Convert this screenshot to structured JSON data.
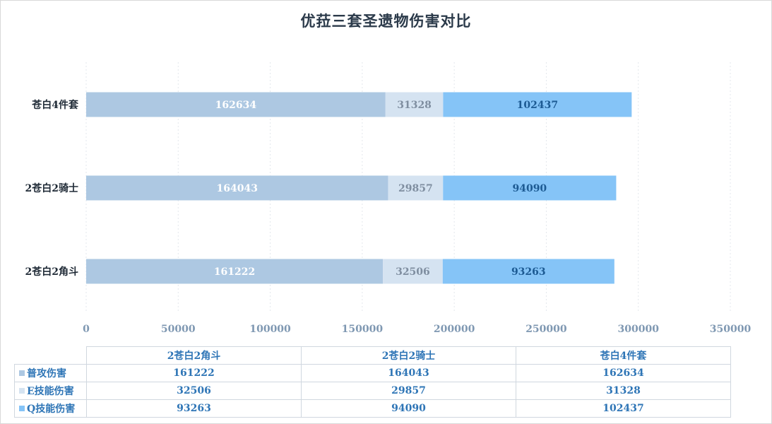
{
  "chart_data": {
    "type": "bar",
    "orientation": "horizontal",
    "stacked": true,
    "title": "优菈三套圣遗物伤害对比",
    "categories": [
      "2苍白2角斗",
      "2苍白2骑士",
      "苍白4件套"
    ],
    "series": [
      {
        "name": "普攻伤害",
        "values": [
          161222,
          164043,
          162634
        ],
        "color": "#adc8e2",
        "label_color": "#ffffff"
      },
      {
        "name": "E技能伤害",
        "values": [
          32506,
          29857,
          31328
        ],
        "color": "#d5e3f1",
        "label_color": "#7f8ea0"
      },
      {
        "name": "Q技能伤害",
        "values": [
          93263,
          94090,
          102437
        ],
        "color": "#85c4f7",
        "label_color": "#1c5a93"
      }
    ],
    "xlim": [
      0,
      350000
    ],
    "xticks": [
      0,
      50000,
      100000,
      150000,
      200000,
      250000,
      300000,
      350000
    ],
    "xlabel": "",
    "ylabel": "",
    "grid": true,
    "legend": "data-table-below"
  }
}
